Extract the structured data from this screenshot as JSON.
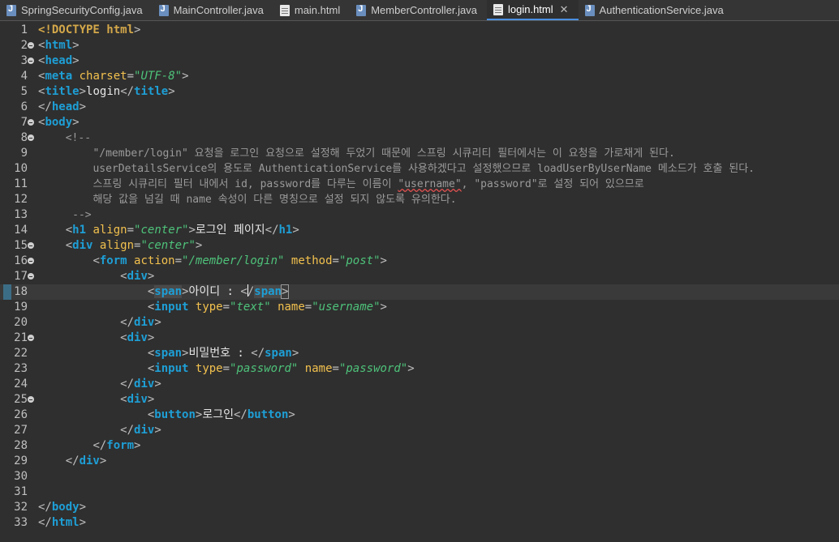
{
  "tabs": [
    {
      "label": "SpringSecurityConfig.java",
      "icon": "java-file-icon",
      "active": false
    },
    {
      "label": "MainController.java",
      "icon": "java-file-icon",
      "active": false
    },
    {
      "label": "main.html",
      "icon": "html-file-icon",
      "active": false
    },
    {
      "label": "MemberController.java",
      "icon": "java-file-icon",
      "active": false
    },
    {
      "label": "login.html",
      "icon": "html-file-icon",
      "active": true
    },
    {
      "label": "AuthenticationService.java",
      "icon": "java-file-icon",
      "active": false
    }
  ],
  "tab_close_glyph": "✕",
  "colors": {
    "accent": "#4a90e2",
    "tag": "#1e9fd6",
    "attribute": "#f2c14e",
    "value": "#4ec27a",
    "comment": "#9a9a9a"
  },
  "lines": [
    {
      "n": "1",
      "fold": false,
      "segs": [
        [
          "doc",
          "<!DOCTYPE"
        ],
        [
          "t",
          " "
        ],
        [
          "doc",
          "html"
        ],
        [
          "br",
          ">"
        ]
      ]
    },
    {
      "n": "2",
      "fold": true,
      "segs": [
        [
          "br",
          "<"
        ],
        [
          "tag",
          "html"
        ],
        [
          "br",
          ">"
        ]
      ]
    },
    {
      "n": "3",
      "fold": true,
      "segs": [
        [
          "br",
          "<"
        ],
        [
          "tag",
          "head"
        ],
        [
          "br",
          ">"
        ]
      ]
    },
    {
      "n": "4",
      "fold": false,
      "segs": [
        [
          "br",
          "<"
        ],
        [
          "tag",
          "meta"
        ],
        [
          "t",
          " "
        ],
        [
          "attr",
          "charset"
        ],
        [
          "br",
          "="
        ],
        [
          "val",
          "\"UTF-8\""
        ],
        [
          "br",
          ">"
        ]
      ]
    },
    {
      "n": "5",
      "fold": false,
      "segs": [
        [
          "br",
          "<"
        ],
        [
          "tag",
          "title"
        ],
        [
          "br",
          ">"
        ],
        [
          "txt",
          "login"
        ],
        [
          "br",
          "</"
        ],
        [
          "tag",
          "title"
        ],
        [
          "br",
          ">"
        ]
      ]
    },
    {
      "n": "6",
      "fold": false,
      "segs": [
        [
          "br",
          "</"
        ],
        [
          "tag",
          "head"
        ],
        [
          "br",
          ">"
        ]
      ]
    },
    {
      "n": "7",
      "fold": true,
      "segs": [
        [
          "br",
          "<"
        ],
        [
          "tag",
          "body"
        ],
        [
          "br",
          ">"
        ]
      ]
    },
    {
      "n": "8",
      "fold": true,
      "segs": [
        [
          "t",
          "    "
        ],
        [
          "cmt",
          "<!--"
        ]
      ]
    },
    {
      "n": "9",
      "fold": false,
      "segs": [
        [
          "t",
          "        "
        ],
        [
          "cmt",
          "\"/member/login\" 요청을 로그인 요청으로 설정해 두었기 때문에 스프링 시큐리티 필터에서는 이 요청을 가로채게 된다."
        ]
      ]
    },
    {
      "n": "10",
      "fold": false,
      "segs": [
        [
          "t",
          "        "
        ],
        [
          "cmt",
          "userDetailsService의 용도로 AuthenticationService를 사용하겠다고 설정했으므로 loadUserByUserName 메소드가 호출 된다."
        ]
      ]
    },
    {
      "n": "11",
      "fold": false,
      "segs": [
        [
          "t",
          "        "
        ],
        [
          "cmt",
          "스프링 시큐리티 필터 내에서 id, password를 다루는 이름이 "
        ],
        [
          "cmt squig",
          "\"username\""
        ],
        [
          "cmt",
          ", \"password\"로 설정 되어 있으므로"
        ]
      ]
    },
    {
      "n": "12",
      "fold": false,
      "segs": [
        [
          "t",
          "        "
        ],
        [
          "cmt",
          "해당 값을 넘길 때 name 속성이 다른 명칭으로 설정 되지 않도록 유의한다."
        ]
      ]
    },
    {
      "n": "13",
      "fold": false,
      "segs": [
        [
          "t",
          "     "
        ],
        [
          "cmt",
          "-->"
        ]
      ]
    },
    {
      "n": "14",
      "fold": false,
      "segs": [
        [
          "t",
          "    "
        ],
        [
          "br",
          "<"
        ],
        [
          "tag",
          "h1"
        ],
        [
          "t",
          " "
        ],
        [
          "attr",
          "align"
        ],
        [
          "br",
          "="
        ],
        [
          "val",
          "\"center\""
        ],
        [
          "br",
          ">"
        ],
        [
          "txt",
          "로그인 페이지"
        ],
        [
          "br",
          "</"
        ],
        [
          "tag",
          "h1"
        ],
        [
          "br",
          ">"
        ]
      ]
    },
    {
      "n": "15",
      "fold": true,
      "segs": [
        [
          "t",
          "    "
        ],
        [
          "br",
          "<"
        ],
        [
          "tag",
          "div"
        ],
        [
          "t",
          " "
        ],
        [
          "attr",
          "align"
        ],
        [
          "br",
          "="
        ],
        [
          "val",
          "\"center\""
        ],
        [
          "br",
          ">"
        ]
      ]
    },
    {
      "n": "16",
      "fold": true,
      "segs": [
        [
          "t",
          "        "
        ],
        [
          "br",
          "<"
        ],
        [
          "tag",
          "form"
        ],
        [
          "t",
          " "
        ],
        [
          "attr",
          "action"
        ],
        [
          "br",
          "="
        ],
        [
          "val",
          "\"/member/login\""
        ],
        [
          "t",
          " "
        ],
        [
          "attr",
          "method"
        ],
        [
          "br",
          "="
        ],
        [
          "val",
          "\"post\""
        ],
        [
          "br",
          ">"
        ]
      ]
    },
    {
      "n": "17",
      "fold": true,
      "segs": [
        [
          "t",
          "            "
        ],
        [
          "br",
          "<"
        ],
        [
          "tag",
          "div"
        ],
        [
          "br",
          ">"
        ]
      ]
    },
    {
      "n": "18",
      "fold": false,
      "current": true,
      "segs": [
        [
          "t",
          "                "
        ],
        [
          "br",
          "<"
        ],
        [
          "tag hl",
          "span"
        ],
        [
          "br",
          ">"
        ],
        [
          "txt",
          "아이디 : "
        ],
        [
          "br",
          "<"
        ],
        [
          "caret",
          ""
        ],
        [
          "br",
          "/"
        ],
        [
          "tag hl",
          "span"
        ],
        [
          "br hlbox",
          ">"
        ]
      ]
    },
    {
      "n": "19",
      "fold": false,
      "segs": [
        [
          "t",
          "                "
        ],
        [
          "br",
          "<"
        ],
        [
          "tag",
          "input"
        ],
        [
          "t",
          " "
        ],
        [
          "attr",
          "type"
        ],
        [
          "br",
          "="
        ],
        [
          "val",
          "\"text\""
        ],
        [
          "t",
          " "
        ],
        [
          "attr",
          "name"
        ],
        [
          "br",
          "="
        ],
        [
          "val",
          "\"username\""
        ],
        [
          "br",
          ">"
        ]
      ]
    },
    {
      "n": "20",
      "fold": false,
      "segs": [
        [
          "t",
          "            "
        ],
        [
          "br",
          "</"
        ],
        [
          "tag",
          "div"
        ],
        [
          "br",
          ">"
        ]
      ]
    },
    {
      "n": "21",
      "fold": true,
      "segs": [
        [
          "t",
          "            "
        ],
        [
          "br",
          "<"
        ],
        [
          "tag",
          "div"
        ],
        [
          "br",
          ">"
        ]
      ]
    },
    {
      "n": "22",
      "fold": false,
      "segs": [
        [
          "t",
          "                "
        ],
        [
          "br",
          "<"
        ],
        [
          "tag",
          "span"
        ],
        [
          "br",
          ">"
        ],
        [
          "txt",
          "비밀번호 : "
        ],
        [
          "br",
          "</"
        ],
        [
          "tag",
          "span"
        ],
        [
          "br",
          ">"
        ]
      ]
    },
    {
      "n": "23",
      "fold": false,
      "segs": [
        [
          "t",
          "                "
        ],
        [
          "br",
          "<"
        ],
        [
          "tag",
          "input"
        ],
        [
          "t",
          " "
        ],
        [
          "attr",
          "type"
        ],
        [
          "br",
          "="
        ],
        [
          "val",
          "\"password\""
        ],
        [
          "t",
          " "
        ],
        [
          "attr",
          "name"
        ],
        [
          "br",
          "="
        ],
        [
          "val",
          "\"password\""
        ],
        [
          "br",
          ">"
        ]
      ]
    },
    {
      "n": "24",
      "fold": false,
      "segs": [
        [
          "t",
          "            "
        ],
        [
          "br",
          "</"
        ],
        [
          "tag",
          "div"
        ],
        [
          "br",
          ">"
        ]
      ]
    },
    {
      "n": "25",
      "fold": true,
      "segs": [
        [
          "t",
          "            "
        ],
        [
          "br",
          "<"
        ],
        [
          "tag",
          "div"
        ],
        [
          "br",
          ">"
        ]
      ]
    },
    {
      "n": "26",
      "fold": false,
      "segs": [
        [
          "t",
          "                "
        ],
        [
          "br",
          "<"
        ],
        [
          "tag",
          "button"
        ],
        [
          "br",
          ">"
        ],
        [
          "txt",
          "로그인"
        ],
        [
          "br",
          "</"
        ],
        [
          "tag",
          "button"
        ],
        [
          "br",
          ">"
        ]
      ]
    },
    {
      "n": "27",
      "fold": false,
      "segs": [
        [
          "t",
          "            "
        ],
        [
          "br",
          "</"
        ],
        [
          "tag",
          "div"
        ],
        [
          "br",
          ">"
        ]
      ]
    },
    {
      "n": "28",
      "fold": false,
      "segs": [
        [
          "t",
          "        "
        ],
        [
          "br",
          "</"
        ],
        [
          "tag",
          "form"
        ],
        [
          "br",
          ">"
        ]
      ]
    },
    {
      "n": "29",
      "fold": false,
      "segs": [
        [
          "t",
          "    "
        ],
        [
          "br",
          "</"
        ],
        [
          "tag",
          "div"
        ],
        [
          "br",
          ">"
        ]
      ]
    },
    {
      "n": "30",
      "fold": false,
      "segs": []
    },
    {
      "n": "31",
      "fold": false,
      "segs": []
    },
    {
      "n": "32",
      "fold": false,
      "segs": [
        [
          "br",
          "</"
        ],
        [
          "tag",
          "body"
        ],
        [
          "br",
          ">"
        ]
      ]
    },
    {
      "n": "33",
      "fold": false,
      "segs": [
        [
          "br",
          "</"
        ],
        [
          "tag",
          "html"
        ],
        [
          "br",
          ">"
        ]
      ]
    }
  ]
}
